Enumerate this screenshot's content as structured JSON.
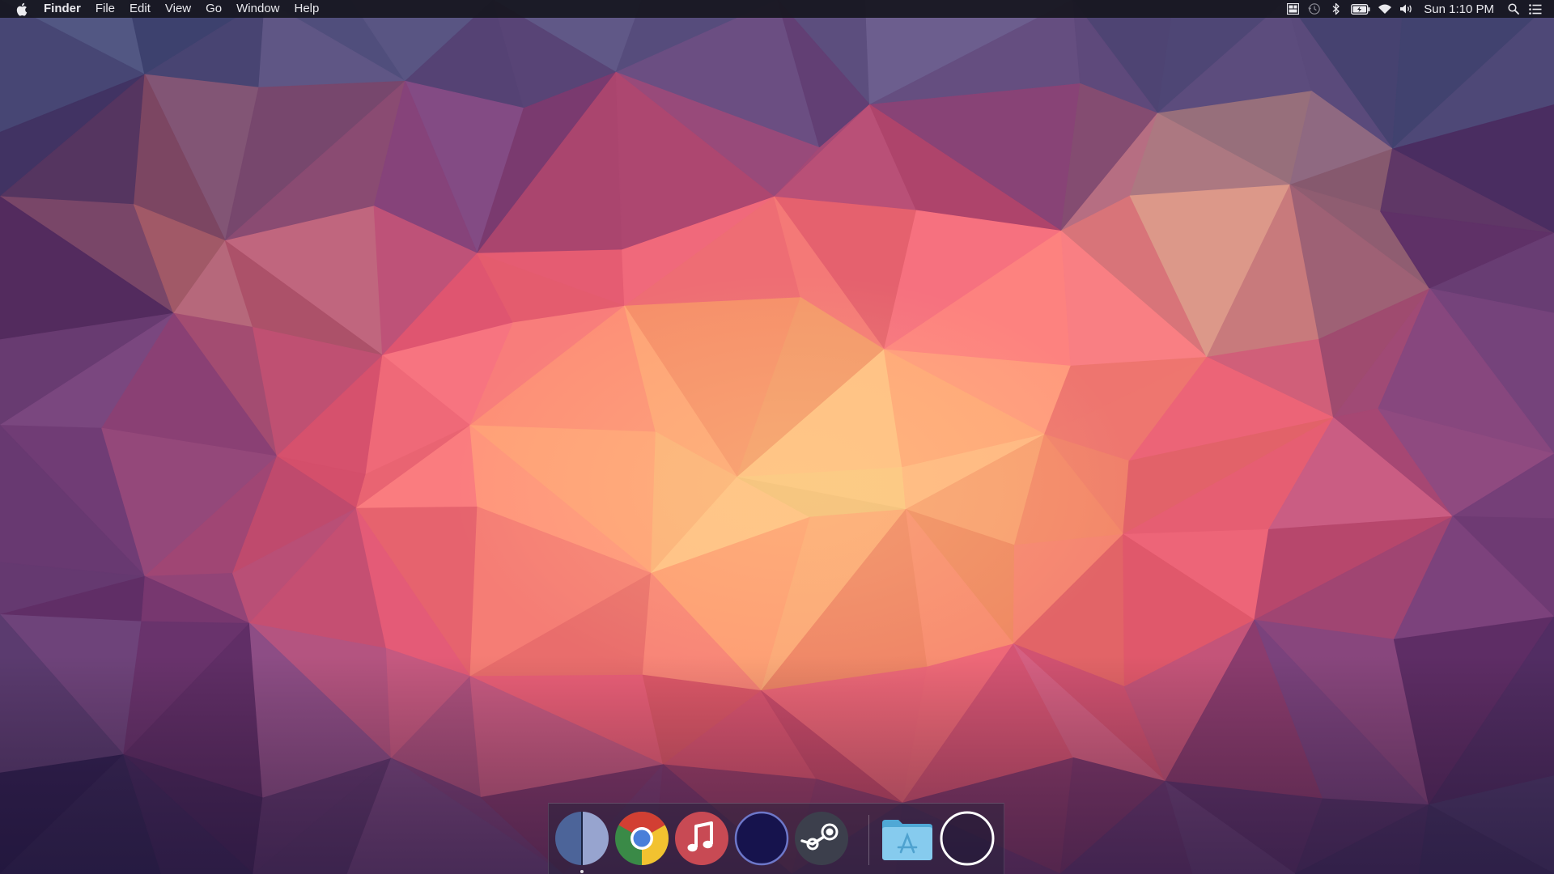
{
  "menubar": {
    "app_name": "Finder",
    "menus": [
      "File",
      "Edit",
      "View",
      "Go",
      "Window",
      "Help"
    ],
    "status_icons": [
      "mission-control-icon",
      "time-machine-icon",
      "bluetooth-icon",
      "battery-icon",
      "wifi-icon",
      "volume-icon"
    ],
    "clock": "Sun 1:10 PM",
    "right_icons": [
      "spotlight-icon",
      "notification-center-icon"
    ]
  },
  "dock": {
    "apps": [
      {
        "name": "finder-icon",
        "running": true
      },
      {
        "name": "chrome-icon",
        "running": false
      },
      {
        "name": "itunes-icon",
        "running": false
      },
      {
        "name": "dark-circle-app-icon",
        "running": false
      },
      {
        "name": "steam-icon",
        "running": false
      }
    ],
    "stacks": [
      {
        "name": "applications-folder-icon"
      },
      {
        "name": "trash-icon"
      }
    ]
  },
  "colors": {
    "menubar_bg": "#16161e",
    "wallpaper_base": "#35284e",
    "wallpaper_warm": "#fc9e74",
    "wallpaper_pink": "#ea5f7a",
    "wallpaper_yellow": "#fde08a",
    "wallpaper_blue": "#5b7aa5"
  }
}
